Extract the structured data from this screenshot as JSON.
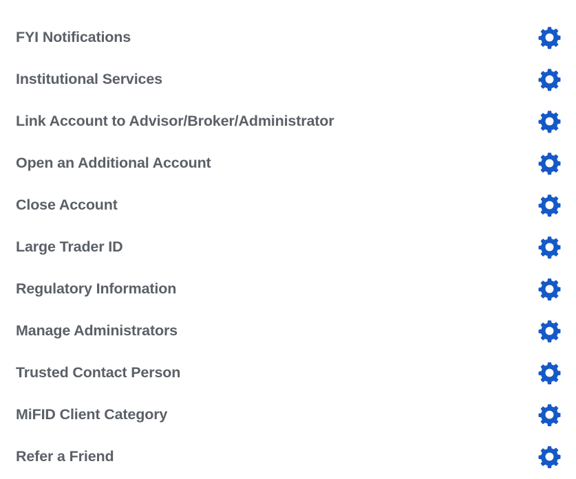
{
  "theme": {
    "background": "#ffffff",
    "label_color": "#5b6067",
    "icon_color": "#1559c7"
  },
  "settings_list": {
    "icon_name": "gear-icon",
    "rows": [
      {
        "label": "FYI Notifications"
      },
      {
        "label": "Institutional Services"
      },
      {
        "label": "Link Account to Advisor/Broker/Administrator"
      },
      {
        "label": "Open an Additional Account"
      },
      {
        "label": "Close Account"
      },
      {
        "label": "Large Trader ID"
      },
      {
        "label": "Regulatory Information"
      },
      {
        "label": "Manage Administrators"
      },
      {
        "label": "Trusted Contact Person"
      },
      {
        "label": "MiFID Client Category"
      },
      {
        "label": "Refer a Friend"
      }
    ]
  }
}
